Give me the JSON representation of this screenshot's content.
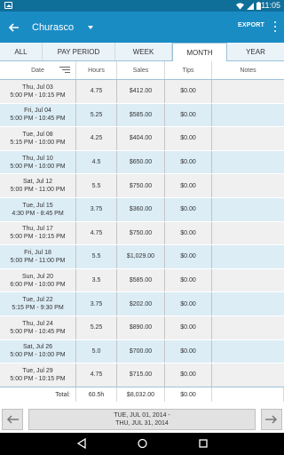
{
  "status_bar": {
    "time": "11:05"
  },
  "app_bar": {
    "spinner_value": "Churasco",
    "export_label": "EXPORT"
  },
  "tabs": [
    {
      "label": "ALL",
      "active": false
    },
    {
      "label": "PAY PERIOD",
      "active": false
    },
    {
      "label": "WEEK",
      "active": false
    },
    {
      "label": "MONTH",
      "active": true
    },
    {
      "label": "YEAR",
      "active": false
    }
  ],
  "columns": {
    "date": "Date",
    "hours": "Hours",
    "sales": "Sales",
    "tips": "Tips",
    "notes": "Notes"
  },
  "rows": [
    {
      "day": "Thu, Jul 03",
      "time": "5:00 PM - 10:15 PM",
      "hours": "4.75",
      "sales": "$412.00",
      "tips": "$0.00",
      "notes": ""
    },
    {
      "day": "Fri, Jul 04",
      "time": "5:00 PM - 10:45 PM",
      "hours": "5.25",
      "sales": "$585.00",
      "tips": "$0.00",
      "notes": ""
    },
    {
      "day": "Tue, Jul 08",
      "time": "5:15 PM - 10:00 PM",
      "hours": "4.25",
      "sales": "$404.00",
      "tips": "$0.00",
      "notes": ""
    },
    {
      "day": "Thu, Jul 10",
      "time": "5:00 PM - 10:00 PM",
      "hours": "4.5",
      "sales": "$650.00",
      "tips": "$0.00",
      "notes": ""
    },
    {
      "day": "Sat, Jul 12",
      "time": "5:00 PM - 11:00 PM",
      "hours": "5.5",
      "sales": "$750.00",
      "tips": "$0.00",
      "notes": ""
    },
    {
      "day": "Tue, Jul 15",
      "time": "4:30 PM - 8:45 PM",
      "hours": "3.75",
      "sales": "$360.00",
      "tips": "$0.00",
      "notes": ""
    },
    {
      "day": "Thu, Jul 17",
      "time": "5:00 PM - 10:15 PM",
      "hours": "4.75",
      "sales": "$750.00",
      "tips": "$0.00",
      "notes": ""
    },
    {
      "day": "Fri, Jul 18",
      "time": "5:00 PM - 11:00 PM",
      "hours": "5.5",
      "sales": "$1,029.00",
      "tips": "$0.00",
      "notes": ""
    },
    {
      "day": "Sun, Jul 20",
      "time": "6:00 PM - 10:00 PM",
      "hours": "3.5",
      "sales": "$585.00",
      "tips": "$0.00",
      "notes": ""
    },
    {
      "day": "Tue, Jul 22",
      "time": "5:15 PM - 9:30 PM",
      "hours": "3.75",
      "sales": "$202.00",
      "tips": "$0.00",
      "notes": ""
    },
    {
      "day": "Thu, Jul 24",
      "time": "5:00 PM - 10:45 PM",
      "hours": "5.25",
      "sales": "$890.00",
      "tips": "$0.00",
      "notes": ""
    },
    {
      "day": "Sat, Jul 26",
      "time": "5:00 PM - 10:00 PM",
      "hours": "5.0",
      "sales": "$700.00",
      "tips": "$0.00",
      "notes": ""
    },
    {
      "day": "Tue, Jul 29",
      "time": "5:00 PM - 10:15 PM",
      "hours": "4.75",
      "sales": "$715.00",
      "tips": "$0.00",
      "notes": ""
    }
  ],
  "totals": {
    "label": "Total:",
    "hours": "60.5h",
    "sales": "$8,032.00",
    "tips": "$0.00"
  },
  "date_range": {
    "start": "TUE, JUL 01, 2014 -",
    "end": "THU, JUL 31, 2014"
  },
  "colors": {
    "status_bar": "#0f6f99",
    "app_bar": "#1a8cc4",
    "row_alt": "#dcedf6",
    "row_base": "#f0f0f0"
  }
}
